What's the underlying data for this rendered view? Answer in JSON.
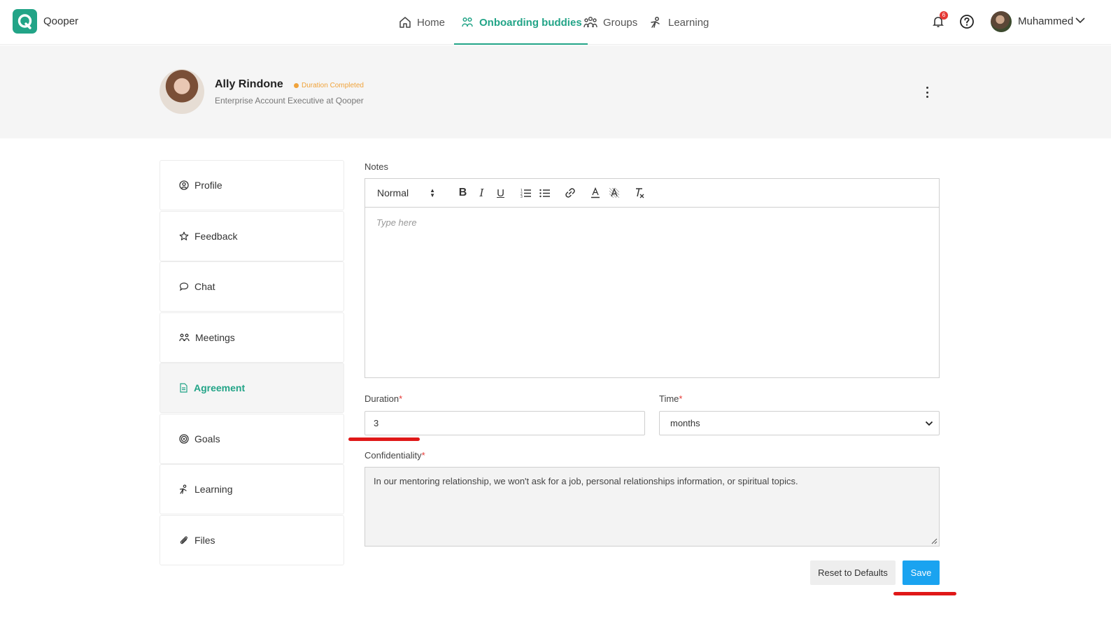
{
  "app": {
    "brand": "Qooper"
  },
  "nav": {
    "items": [
      {
        "label": "Home",
        "icon": "home-icon"
      },
      {
        "label": "Onboarding buddies",
        "icon": "buddies-icon",
        "active": true
      },
      {
        "label": "Groups",
        "icon": "groups-icon"
      },
      {
        "label": "Learning",
        "icon": "learning-icon"
      }
    ]
  },
  "header_right": {
    "notification_count": "6",
    "username": "Muhammed"
  },
  "profile": {
    "name": "Ally Rindone",
    "status": "Duration Completed",
    "title": "Enterprise Account Executive at Qooper"
  },
  "sidebar": {
    "items": [
      {
        "label": "Profile",
        "icon": "profile-icon"
      },
      {
        "label": "Feedback",
        "icon": "star-icon"
      },
      {
        "label": "Chat",
        "icon": "chat-icon"
      },
      {
        "label": "Meetings",
        "icon": "meetings-icon"
      },
      {
        "label": "Agreement",
        "icon": "document-icon",
        "active": true
      },
      {
        "label": "Goals",
        "icon": "target-icon"
      },
      {
        "label": "Learning",
        "icon": "learning-icon"
      },
      {
        "label": "Files",
        "icon": "paperclip-icon"
      }
    ]
  },
  "form": {
    "notes_label": "Notes",
    "toolbar": {
      "format": "Normal"
    },
    "notes_placeholder": "Type here",
    "duration_label": "Duration",
    "duration_value": "3",
    "time_label": "Time",
    "time_value": "months",
    "confidentiality_label": "Confidentiality",
    "confidentiality_value": "In our mentoring relationship, we won't ask for a job, personal relationships information, or spiritual topics.",
    "required_mark": "*",
    "reset_label": "Reset to Defaults",
    "save_label": "Save"
  },
  "colors": {
    "accent": "#22a487",
    "save": "#1aa3f0",
    "status": "#f0a33b",
    "annotation": "#e01818"
  }
}
